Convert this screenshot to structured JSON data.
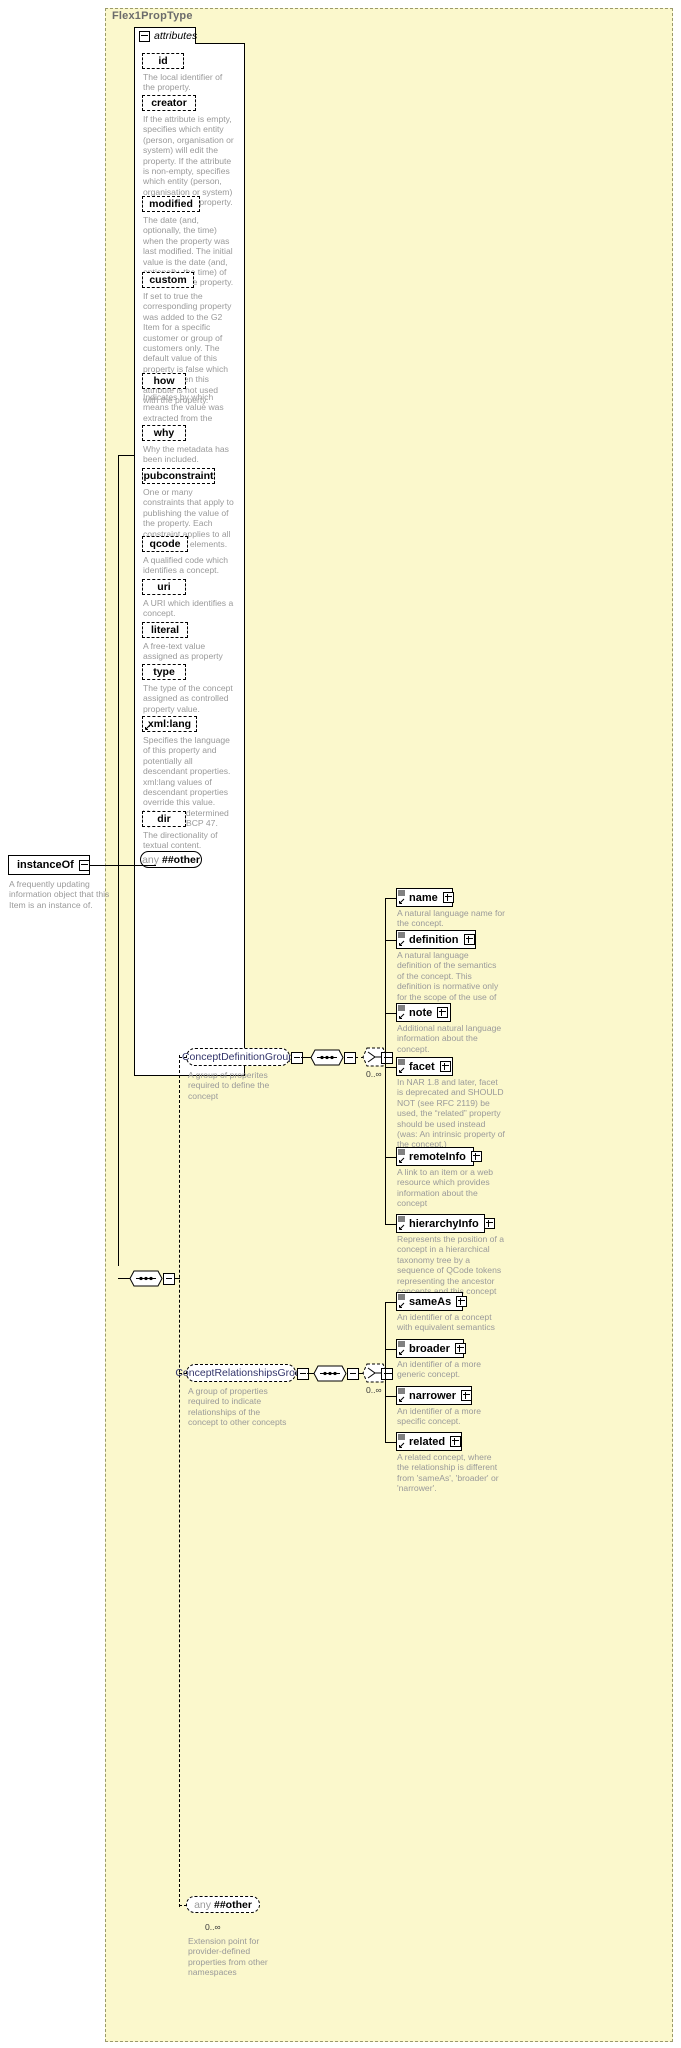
{
  "diagram": {
    "type_name": "Flex1PropType",
    "attributes_label": "attributes"
  },
  "attributes": [
    {
      "name": "id",
      "doc": "The local identifier of the property."
    },
    {
      "name": "creator",
      "doc": "If the attribute is empty, specifies which entity (person, organisation or system) will edit the property. If the attribute is non-empty, specifies which entity (person, organisation or system) has edited the property."
    },
    {
      "name": "modified",
      "doc": "The date (and, optionally, the time) when the property was last modified. The initial value is the date (and, optionally, the time) of creation of the property."
    },
    {
      "name": "custom",
      "doc": "If set to true the corresponding property was added to the G2 Item for a specific customer or group of customers only. The default value of this property is false which applies when this attribute is not used with the property."
    },
    {
      "name": "how",
      "doc": "Indicates by which means the value was extracted from the content."
    },
    {
      "name": "why",
      "doc": "Why the metadata has been included."
    },
    {
      "name": "pubconstraint",
      "doc": "One or many constraints that apply to publishing the value of the property. Each constraint applies to all descendant elements."
    },
    {
      "name": "qcode",
      "doc": "A qualified code which identifies a concept."
    },
    {
      "name": "uri",
      "doc": "A URI which identifies a concept."
    },
    {
      "name": "literal",
      "doc": "A free-text value assigned as property value."
    },
    {
      "name": "type",
      "doc": "The type of the concept assigned as controlled property value."
    },
    {
      "name": "xmllang",
      "doc": "Specifies the language of this property and potentially all descendant properties. xml:lang values of descendant properties override this value. Values are determined by Internet BCP 47."
    },
    {
      "name": "dir",
      "doc": "The directionality of textual content."
    }
  ],
  "attribute_labels": {
    "id": "id",
    "creator": "creator",
    "modified": "modified",
    "custom": "custom",
    "how": "how",
    "why": "why",
    "pubconstraint": "pubconstraint",
    "qcode": "qcode",
    "uri": "uri",
    "literal": "literal",
    "type": "type",
    "xmllang": "xml:lang",
    "dir": "dir"
  },
  "attributes_any": {
    "prefix": "any",
    "namespace": "##other"
  },
  "root": {
    "label": "instanceOf",
    "doc": "A frequently updating information object that this Item is an instance of."
  },
  "groups": [
    {
      "name": "ConceptDefinitionGroup",
      "doc": "A group of properites required to define the concept",
      "cardinality": "0..∞"
    },
    {
      "name": "ConceptRelationshipsGroup",
      "doc": "A group of properties required to indicate relationships of the concept to other concepts",
      "cardinality": "0..∞"
    }
  ],
  "definition_elements": [
    {
      "label": "name",
      "doc": "A natural language name for the concept."
    },
    {
      "label": "definition",
      "doc": "A natural language definition of the semantics of the concept. This definition is normative only for the scope of the use of this concept."
    },
    {
      "label": "note",
      "doc": "Additional natural language information about the concept."
    },
    {
      "label": "facet",
      "doc": "In NAR 1.8 and later, facet is deprecated and SHOULD NOT (see RFC 2119) be used, the “related” property should be used instead (was: An intrinsic property of the concept.)"
    },
    {
      "label": "remoteInfo",
      "doc": "A link to an item or a web resource which provides information about the concept"
    },
    {
      "label": "hierarchyInfo",
      "doc": "Represents the position of a concept in a hierarchical taxonomy tree by a sequence of QCode tokens representing the ancestor concepts and this concept"
    }
  ],
  "relationship_elements": [
    {
      "label": "sameAs",
      "doc": "An identifier of a concept with equivalent semantics"
    },
    {
      "label": "broader",
      "doc": "An identifier of a more generic concept."
    },
    {
      "label": "narrower",
      "doc": "An identifier of a more specific concept."
    },
    {
      "label": "related",
      "doc": "A related concept, where the relationship is different from 'sameAs', 'broader' or 'narrower'."
    }
  ],
  "extension_any": {
    "prefix": "any",
    "namespace": "##other",
    "cardinality": "0..∞",
    "doc": "Extension point for provider-defined properties from other namespaces"
  },
  "colors": {
    "panel_bg": "#fbf8cc",
    "panel_border": "#9a9a6a",
    "doc_text": "#9a9a9a",
    "node_shadow": "#c9c9c9",
    "group_text": "#33356b"
  }
}
